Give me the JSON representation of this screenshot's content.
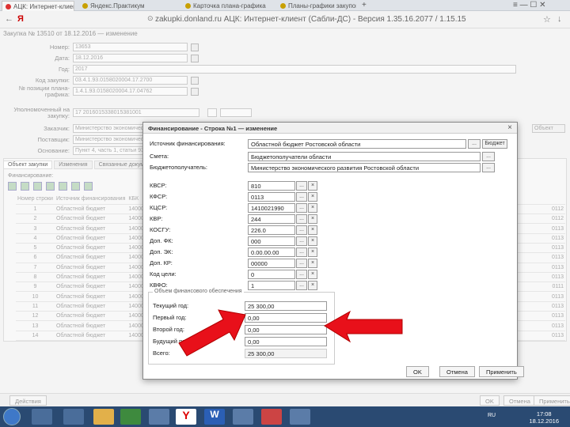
{
  "browser": {
    "tabs": [
      {
        "label": "АЦК: Интернет-клиент",
        "close": "×"
      },
      {
        "label": "Яндекс.Практикум"
      },
      {
        "label": "Карточка плана-графика"
      },
      {
        "label": "Планы-графики закупок"
      }
    ],
    "new_tab": "+",
    "win_controls": "≡ — ☐ ✕",
    "url": "zakupki.donland.ru  АЦК: Интернет-клиент (Сабли-ДС) - Версия 1.35.16.2077 / 1.15.15",
    "ya": "Я"
  },
  "page": {
    "title": "Закупка № 13510 от 18.12.2016 — изменение",
    "fields": [
      {
        "label": "Номер:",
        "value": "13653"
      },
      {
        "label": "Дата:",
        "value": "18.12.2016"
      },
      {
        "label": "Год:",
        "value": "2017"
      },
      {
        "label": "Код закупки:",
        "value": "03.4.1.93.0158020004.17.2700"
      },
      {
        "label": "№ позиции плана-графика:",
        "value": "1.4.1.93.0158020004.17.04762"
      },
      {
        "label": "Уполномоченный на закупку:",
        "value": "17  2016015338015381001"
      },
      {
        "label": "Заказчик:",
        "value": "Министерство экономического развития"
      },
      {
        "label": "Поставщик:",
        "value": "Министерство экономического развития"
      },
      {
        "label": "Основание:",
        "value": "Пункт 4, часть 1, статьи 93"
      }
    ],
    "right_btn": "Объект",
    "tabs": [
      "Объект закупки",
      "Изменения",
      "Связанные документы"
    ],
    "subtitle": "Финансирование:",
    "grid_header": [
      "Номер строки",
      "Источник финансирования",
      "КБК"
    ],
    "grid_rows": [
      {
        "n": "1",
        "src": "Областной бюджет",
        "kbk": "1400021590",
        "code": "0112"
      },
      {
        "n": "2",
        "src": "Областной бюджет",
        "kbk": "1400021590",
        "code": "0112"
      },
      {
        "n": "3",
        "src": "Областной бюджет",
        "kbk": "1400022590",
        "code": "0113"
      },
      {
        "n": "4",
        "src": "Областной бюджет",
        "kbk": "1400022590",
        "code": "0113"
      },
      {
        "n": "5",
        "src": "Областной бюджет",
        "kbk": "1400022000",
        "code": "0113"
      },
      {
        "n": "6",
        "src": "Областной бюджет",
        "kbk": "1400022000",
        "code": "0113"
      },
      {
        "n": "7",
        "src": "Областной бюджет",
        "kbk": "1400022190",
        "code": "0113"
      },
      {
        "n": "8",
        "src": "Областной бюджет",
        "kbk": "1400022190",
        "code": "0113"
      },
      {
        "n": "9",
        "src": "Областной бюджет",
        "kbk": "1400022190",
        "code": "0111"
      },
      {
        "n": "10",
        "src": "Областной бюджет",
        "kbk": "1400022190",
        "code": "0113"
      },
      {
        "n": "11",
        "src": "Областной бюджет",
        "kbk": "1400022190",
        "code": "0113"
      },
      {
        "n": "12",
        "src": "Областной бюджет",
        "kbk": "1400022190",
        "code": "0113"
      },
      {
        "n": "13",
        "src": "Областной бюджет",
        "kbk": "1400022190",
        "code": "0113"
      },
      {
        "n": "14",
        "src": "Областной бюджет",
        "kbk": "1400022190",
        "code": "0113"
      }
    ],
    "footer_left": "Действия",
    "footer_buttons": [
      "OK",
      "Отмена",
      "Применить"
    ]
  },
  "dialog": {
    "title": "Финансирование - Строка №1 — изменение",
    "close": "×",
    "rows": [
      {
        "label": "Источник финансирования:",
        "value": "Областной бюджет Ростовской области",
        "btn": "...",
        "extra": "Бюджет"
      },
      {
        "label": "Смета:",
        "value": "Бюджетополучатели области"
      },
      {
        "label": "Бюджетополучатель:",
        "value": "Министерство экономического развития Ростовской области"
      }
    ],
    "codes": [
      {
        "label": "КВСР:",
        "value": "810"
      },
      {
        "label": "КФСР:",
        "value": "0113"
      },
      {
        "label": "КЦСР:",
        "value": "1410021990"
      },
      {
        "label": "КВР:",
        "value": "244"
      },
      {
        "label": "КОСГУ:",
        "value": "226.0"
      },
      {
        "label": "Доп. ФК:",
        "value": "000"
      },
      {
        "label": "Доп. ЭК:",
        "value": "0.00.00.00"
      },
      {
        "label": "Доп. КР:",
        "value": "00000"
      },
      {
        "label": "Код цели:",
        "value": "0"
      },
      {
        "label": "КВФО:",
        "value": "1"
      }
    ],
    "fin_title": "Объем финансового обеспечения",
    "fin": [
      {
        "label": "Текущий год:",
        "value": "25 300,00"
      },
      {
        "label": "Первый год:",
        "value": "0,00"
      },
      {
        "label": "Второй год:",
        "value": "0,00"
      },
      {
        "label": "Будущий период:",
        "value": "0,00"
      },
      {
        "label": "Всего:",
        "value": "25 300,00"
      }
    ],
    "buttons": [
      "OK",
      "Отмена",
      "Применить"
    ]
  },
  "taskbar": {
    "time": "17:08",
    "date": "18.12.2016",
    "lang": "RU"
  },
  "colors": {
    "arrow": "#e8101a",
    "taskbar": "#2a4a72"
  }
}
